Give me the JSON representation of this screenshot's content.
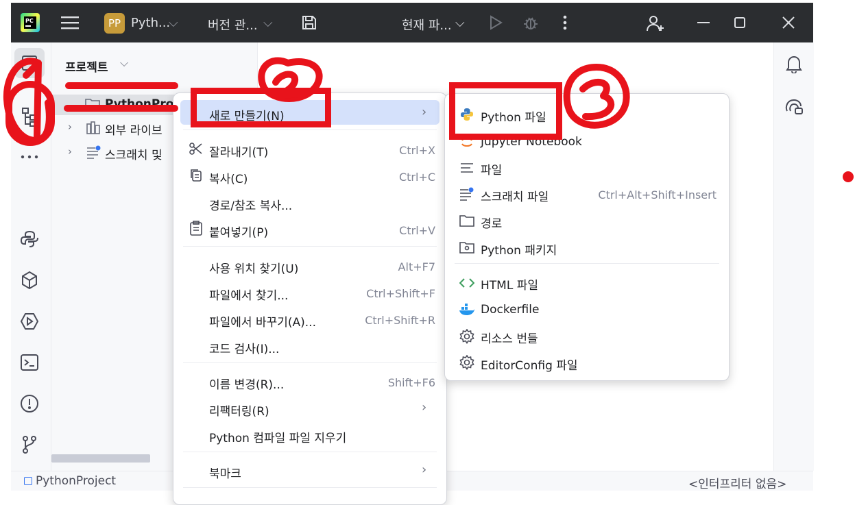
{
  "titlebar": {
    "project_badge": "PP",
    "project_name": "Pyth...",
    "vcs": "버전 관...",
    "run_config": "현재 파..."
  },
  "project_panel": {
    "title": "프로젝트",
    "items": [
      {
        "label": "PythonProject"
      },
      {
        "label": "외부 라이브"
      },
      {
        "label": "스크래치 및"
      }
    ]
  },
  "context_menu": {
    "items": [
      {
        "label": "새로 만들기(N)"
      },
      {
        "label": "잘라내기(T)",
        "shortcut": "Ctrl+X"
      },
      {
        "label": "복사(C)",
        "shortcut": "Ctrl+C"
      },
      {
        "label": "경로/참조 복사..."
      },
      {
        "label": "붙여넣기(P)",
        "shortcut": "Ctrl+V"
      },
      {
        "label": "사용 위치 찾기(U)",
        "shortcut": "Alt+F7"
      },
      {
        "label": "파일에서 찾기...",
        "shortcut": "Ctrl+Shift+F"
      },
      {
        "label": "파일에서 바꾸기(A)...",
        "shortcut": "Ctrl+Shift+R"
      },
      {
        "label": "코드 검사(I)..."
      },
      {
        "label": "이름 변경(R)...",
        "shortcut": "Shift+F6"
      },
      {
        "label": "리팩터링(R)"
      },
      {
        "label": "Python 컴파일 파일 지우기"
      },
      {
        "label": "북마크"
      }
    ]
  },
  "submenu": {
    "items": [
      {
        "label": "Python 파일"
      },
      {
        "label": "Jupyter Notebook"
      },
      {
        "label": "파일"
      },
      {
        "label": "스크래치 파일",
        "shortcut": "Ctrl+Alt+Shift+Insert"
      },
      {
        "label": "경로"
      },
      {
        "label": "Python 패키지"
      },
      {
        "label": "HTML 파일"
      },
      {
        "label": "Dockerfile"
      },
      {
        "label": "리소스 번들"
      },
      {
        "label": "EditorConfig 파일"
      }
    ]
  },
  "statusbar": {
    "project": "PythonProject",
    "interpreter": "<인터프리터 없음>"
  },
  "colors": {
    "annotation_red": "#e8131b",
    "titlebar_bg": "#2b2d30",
    "menu_highlight": "#d5e1fb"
  }
}
